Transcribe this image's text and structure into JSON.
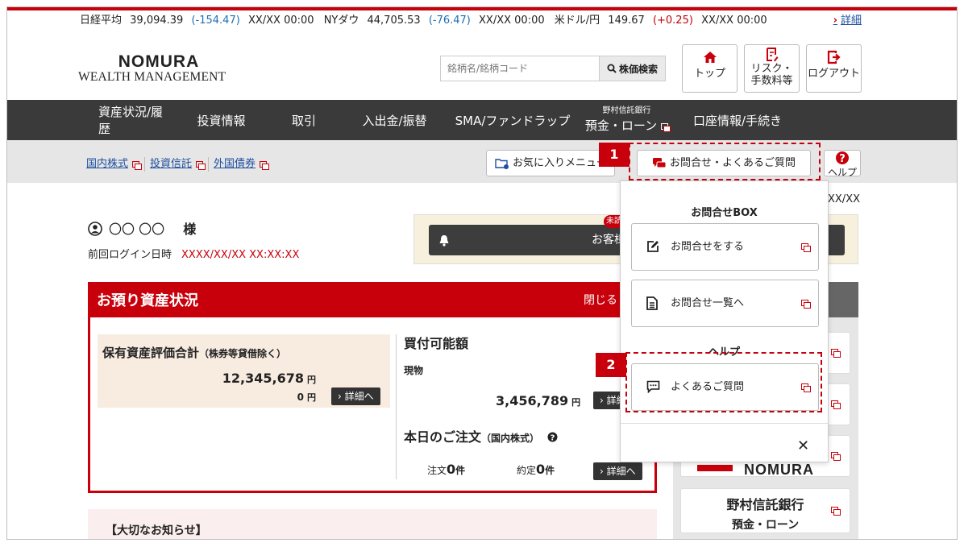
{
  "ticker": {
    "nikkei_label": "日経平均",
    "nikkei_value": "39,094.39",
    "nikkei_change": "(-154.47)",
    "nikkei_time": "XX/XX 00:00",
    "ny_label": "NYダウ",
    "ny_value": "44,705.53",
    "ny_change": "(-76.47)",
    "ny_time": "XX/XX 00:00",
    "usd_label": "米ドル/円",
    "usd_value": "149.67",
    "usd_change": "(+0.25)",
    "usd_time": "XX/XX 00:00",
    "detail_link": "詳細",
    "negative_color": "#1f6fb4",
    "positive_color": "#c8000b"
  },
  "header": {
    "logo_line1": "NOMURA",
    "logo_line2": "WEALTH MANAGEMENT",
    "search_placeholder": "銘柄名/銘柄コード",
    "search_button": "株価検索",
    "buttons": [
      {
        "label": "トップ",
        "icon": "home-icon"
      },
      {
        "label": "リスク・手数料等",
        "icon": "document-icon"
      },
      {
        "label": "ログアウト",
        "icon": "logout-icon"
      }
    ]
  },
  "mainnav": {
    "items": [
      {
        "label": "資産状況/履歴",
        "sub": ""
      },
      {
        "label": "投資情報",
        "sub": ""
      },
      {
        "label": "取引",
        "sub": ""
      },
      {
        "label": "入出金/振替",
        "sub": ""
      },
      {
        "label": "SMA/ファンドラップ",
        "sub": ""
      },
      {
        "label": "預金・ローン",
        "sub": "野村信託銀行"
      },
      {
        "label": "口座情報/手続き",
        "sub": ""
      }
    ]
  },
  "subnav": {
    "links": [
      "国内株式",
      "投資信託",
      "外国債券"
    ],
    "favorites": "お気に入りメニュー",
    "inquiry": "お問合せ・よくあるご質問",
    "help": "ヘルプ",
    "badge1": "1",
    "badge2": "2"
  },
  "user": {
    "name": "〇〇 〇〇",
    "honorific": "様",
    "last_login_label": "前回ログイン日時",
    "last_login_value": "XXXX/XX/XX XX:XX:XX",
    "contact_button": "お客様へのご連絡",
    "unread_badge": "未読",
    "date_fragment": "XX/XX"
  },
  "assets": {
    "title": "お預り資産状況",
    "close": "閉じる",
    "holdings_title": "保有資産評価合計",
    "holdings_note": "（株券等貸借除く）",
    "holdings_value": "12,345,678",
    "holdings_unit": "円",
    "holdings_value2": "0",
    "holdings_unit2": "円",
    "detail_button": "詳細へ",
    "buying_power_title": "買付可能額",
    "cash_label": "現物",
    "buying_power_value": "3,456,789",
    "buying_power_unit": "円",
    "orders_title": "本日のご注文",
    "orders_note": "（国内株式）",
    "orders_label": "注文",
    "orders_count": "0",
    "orders_unit": "件",
    "executed_label": "約定",
    "executed_count": "0",
    "executed_unit": "件"
  },
  "notice": {
    "title": "【大切なお知らせ】"
  },
  "rightcol": {
    "trust_bank": "野村信託銀行",
    "trust_bank_sub": "預金・ローン",
    "partial_brand": "NOMURA"
  },
  "dropdown": {
    "section1": "お問合せBOX",
    "item1": "お問合せをする",
    "item2": "お問合せ一覧へ",
    "section2": "ヘルプ",
    "item3": "よくあるご質問",
    "close": "✕"
  }
}
